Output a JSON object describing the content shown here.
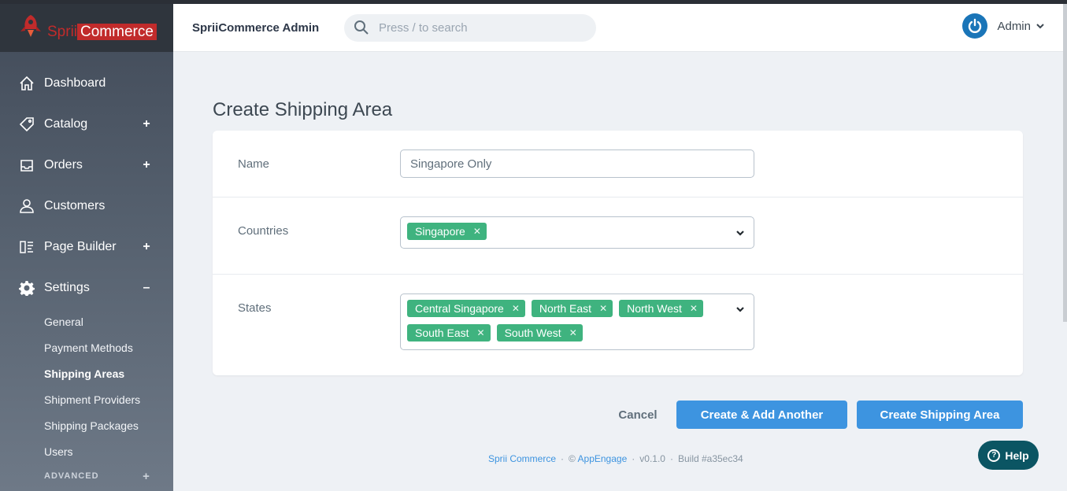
{
  "brand": {
    "logo_part1": "Sprii",
    "logo_part2": "Commerce",
    "app_title": "SpriiCommerce Admin"
  },
  "search": {
    "placeholder": "Press / to search"
  },
  "user": {
    "name": "Admin"
  },
  "sidebar": {
    "items": [
      {
        "label": "Dashboard",
        "icon": "home-icon",
        "toggle": ""
      },
      {
        "label": "Catalog",
        "icon": "tag-icon",
        "toggle": "+"
      },
      {
        "label": "Orders",
        "icon": "inbox-icon",
        "toggle": "+"
      },
      {
        "label": "Customers",
        "icon": "user-icon",
        "toggle": ""
      },
      {
        "label": "Page Builder",
        "icon": "page-builder-icon",
        "toggle": "+"
      },
      {
        "label": "Settings",
        "icon": "gear-icon",
        "toggle": "–"
      }
    ],
    "settings_sub": [
      "General",
      "Payment Methods",
      "Shipping Areas",
      "Shipment Providers",
      "Shipping Packages",
      "Users"
    ],
    "active_sub": "Shipping Areas",
    "advanced": {
      "label": "ADVANCED",
      "toggle": "+"
    }
  },
  "page": {
    "title": "Create Shipping Area"
  },
  "form": {
    "name": {
      "label": "Name",
      "value": "Singapore Only"
    },
    "countries": {
      "label": "Countries",
      "tags": [
        "Singapore"
      ]
    },
    "states": {
      "label": "States",
      "tags": [
        "Central Singapore",
        "North East",
        "North West",
        "South East",
        "South West"
      ]
    }
  },
  "actions": {
    "cancel": "Cancel",
    "create_add": "Create & Add Another",
    "create": "Create Shipping Area"
  },
  "footer": {
    "brand": "Sprii Commerce",
    "copyright": "©",
    "company": "AppEngage",
    "version": "v0.1.0",
    "build": "Build #a35ec34"
  },
  "help": {
    "label": "Help"
  },
  "colors": {
    "accent": "#3d94e0",
    "tag": "#3fb37f",
    "brand_red": "#c12b2b",
    "help_bg": "#0b5563"
  }
}
